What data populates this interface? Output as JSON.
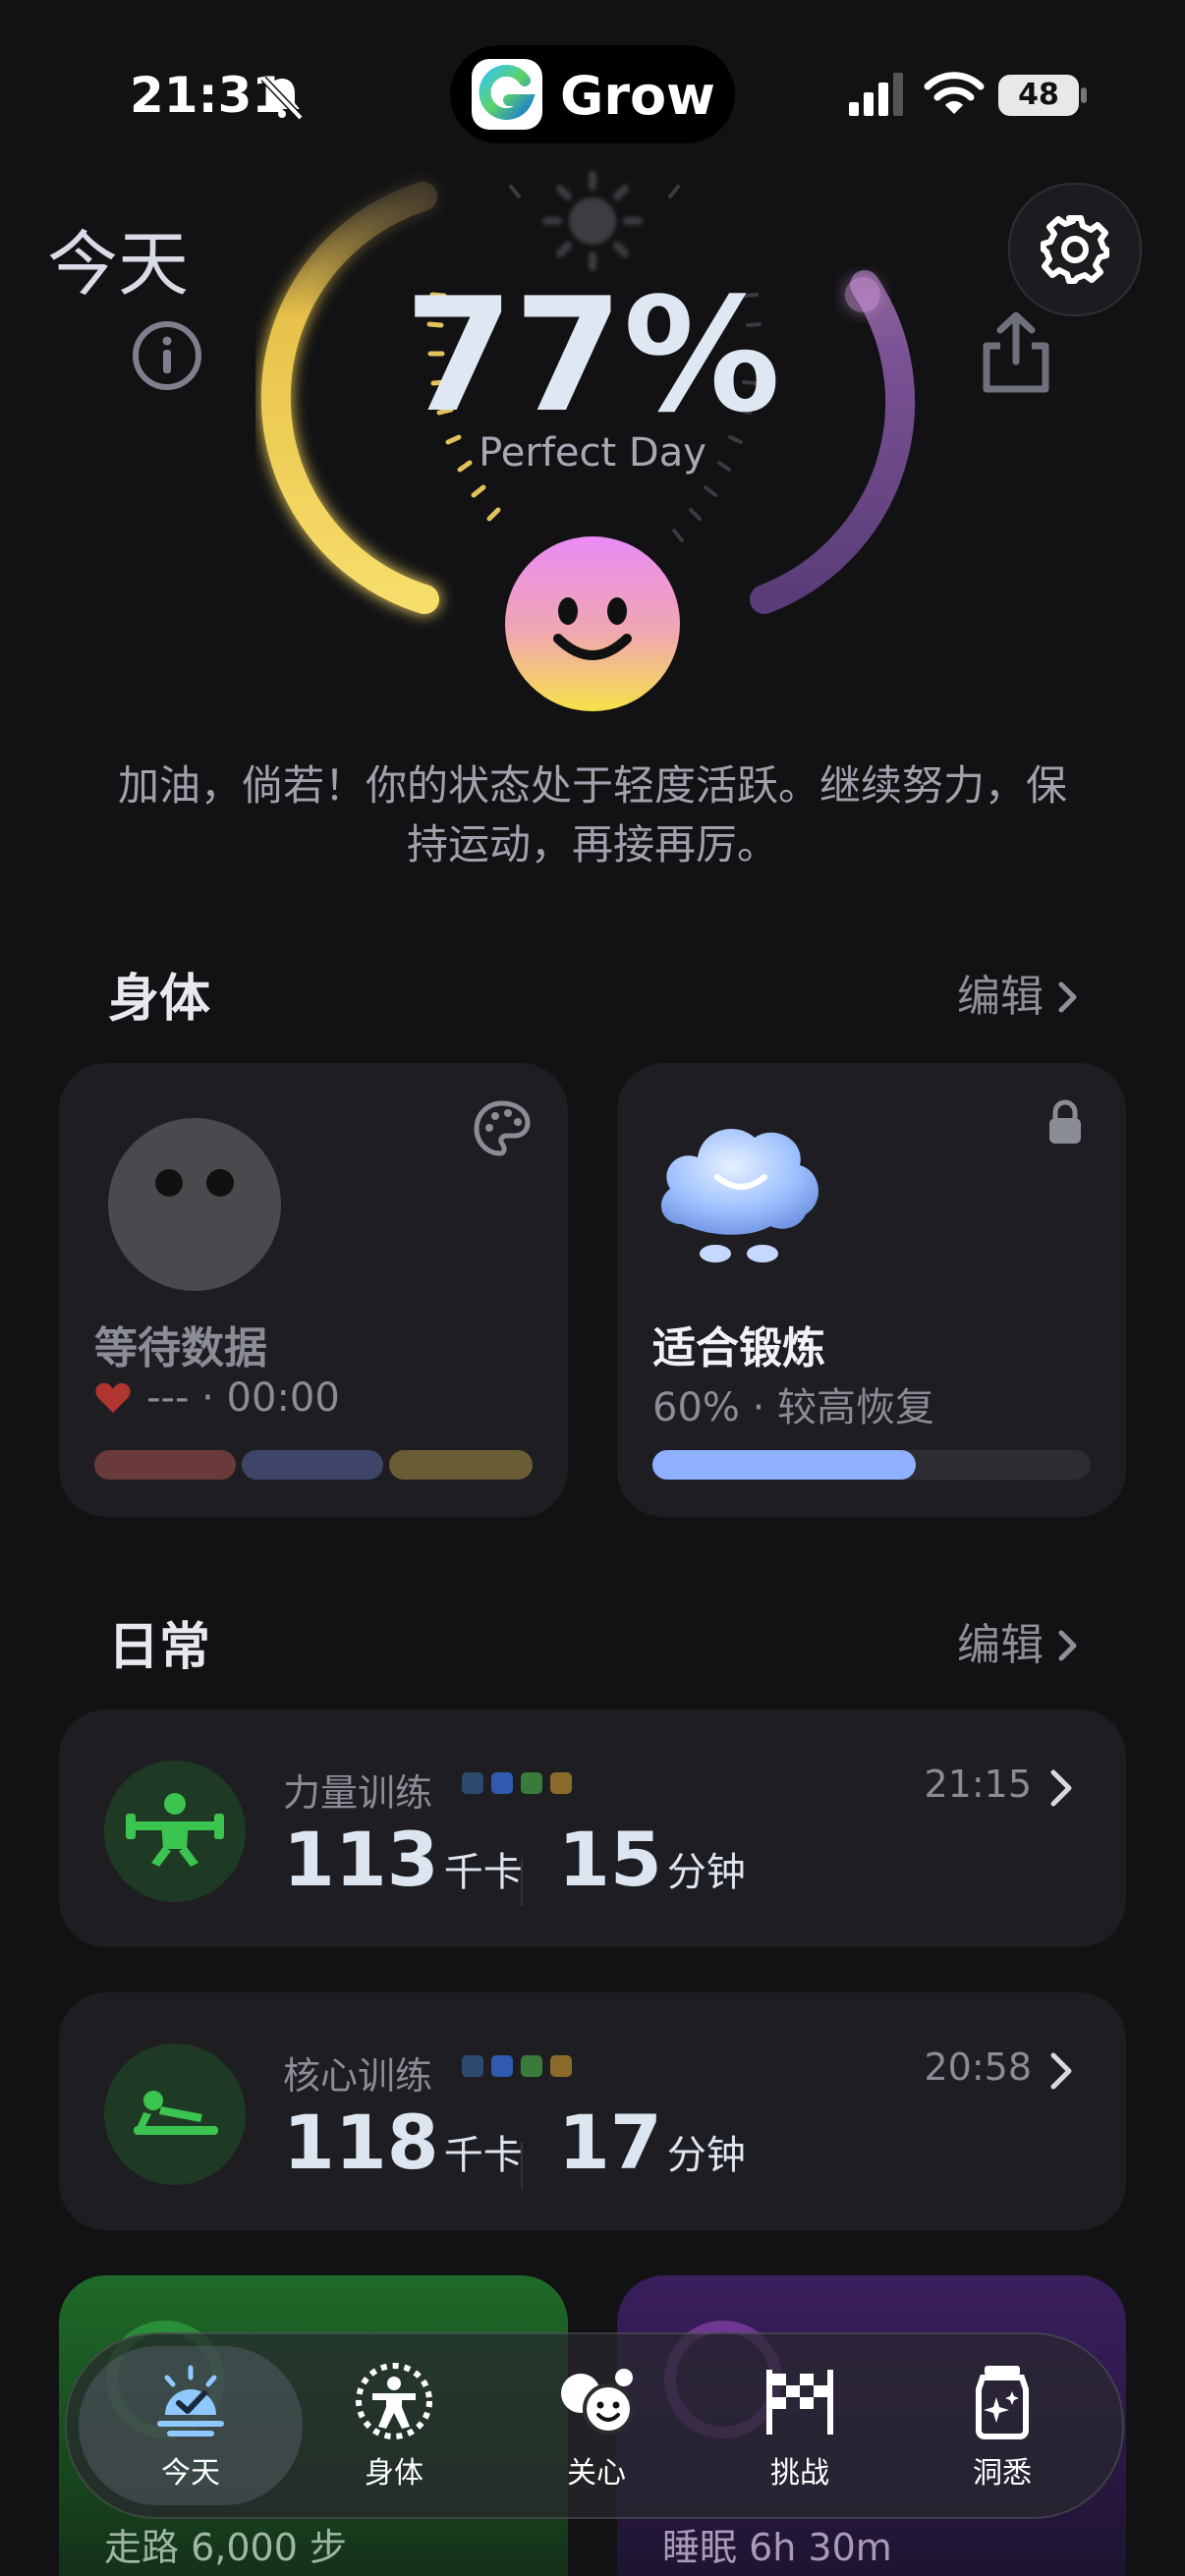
{
  "status_bar": {
    "time": "21:31",
    "battery": "48"
  },
  "app": {
    "name": "Grow"
  },
  "header": {
    "title": "今天"
  },
  "score": {
    "percent": "77%",
    "label": "Perfect Day",
    "value": 0.77
  },
  "message": "加油，倘若！你的状态处于轻度活跃。继续努力，保持运动，再接再厉。",
  "body_section": {
    "title": "身体",
    "edit_label": "编辑",
    "card_waiting": {
      "title": "等待数据",
      "heart_info": "--- · 00:00"
    },
    "card_exercise": {
      "title": "适合锻炼",
      "subtitle": "60% · 较高恢复",
      "progress": 0.6
    }
  },
  "daily_section": {
    "title": "日常",
    "edit_label": "编辑",
    "workouts": [
      {
        "name": "力量训练",
        "time": "21:15",
        "calories": "113",
        "calories_unit": "千卡",
        "duration": "15",
        "duration_unit": "分钟"
      },
      {
        "name": "核心训练",
        "time": "20:58",
        "calories": "118",
        "calories_unit": "千卡",
        "duration": "17",
        "duration_unit": "分钟"
      }
    ]
  },
  "bottom_cards": [
    {
      "text": "走路 6,000 步"
    },
    {
      "text": "睡眠 6h 30m"
    }
  ],
  "tabs": [
    {
      "label": "今天",
      "icon": "sunrise-check-icon",
      "active": true
    },
    {
      "label": "身体",
      "icon": "body-figure-icon",
      "active": false
    },
    {
      "label": "关心",
      "icon": "care-faces-icon",
      "active": false
    },
    {
      "label": "挑战",
      "icon": "checkered-flag-icon",
      "active": false
    },
    {
      "label": "洞悉",
      "icon": "sparkle-jar-icon",
      "active": false
    }
  ],
  "colors": {
    "background": "#121214",
    "card": "#1e1e22",
    "accent_green": "#2fa84a",
    "progress_blue": "#8fb0ff",
    "ring_yellow": "#f4d35e",
    "ring_purple": "#6b4a8a"
  }
}
